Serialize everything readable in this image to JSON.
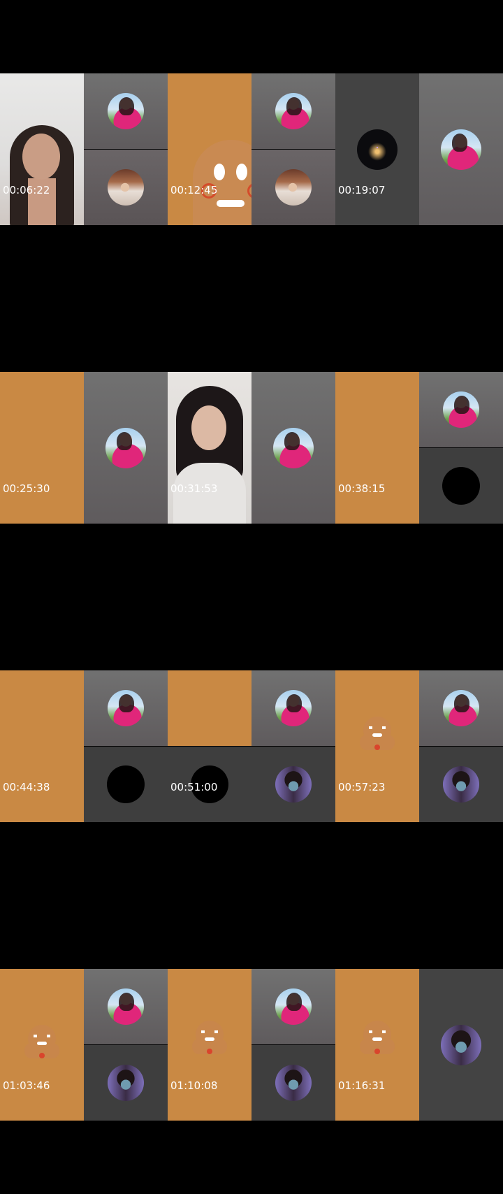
{
  "thumbnails": [
    {
      "timestamp": "00:06:22",
      "layout": "person-a | avatar-pink / avatar-man"
    },
    {
      "timestamp": "00:12:45",
      "layout": "gingerbread-large | avatar-pink / avatar-man"
    },
    {
      "timestamp": "00:19:07",
      "layout": "avatar-dark-logo | avatar-pink"
    },
    {
      "timestamp": "00:25:30",
      "layout": "orange | avatar-pink"
    },
    {
      "timestamp": "00:31:53",
      "layout": "person-b | avatar-pink"
    },
    {
      "timestamp": "00:38:15",
      "layout": "orange | avatar-pink / avatar-black"
    },
    {
      "timestamp": "00:44:38",
      "layout": "orange | avatar-pink / avatar-black"
    },
    {
      "timestamp": "00:51:00",
      "layout": "orange / avatar-black | avatar-pink / avatar-elephant"
    },
    {
      "timestamp": "00:57:23",
      "layout": "gingerbread-small | avatar-pink / avatar-elephant"
    },
    {
      "timestamp": "01:03:46",
      "layout": "gingerbread-small | avatar-pink / avatar-elephant"
    },
    {
      "timestamp": "01:10:08",
      "layout": "gingerbread-small | avatar-pink / avatar-elephant"
    },
    {
      "timestamp": "01:16:31",
      "layout": "gingerbread-small | avatar-elephant"
    }
  ],
  "colors": {
    "background": "#000000",
    "gingerbread_orange": "#c98944",
    "grey_panel": "#5f5b5d",
    "dark_panel": "#434343",
    "label_text": "#ffffff"
  },
  "icons": [
    "avatar-pink-icon",
    "avatar-man-icon",
    "avatar-dark-logo-icon",
    "avatar-black-icon",
    "avatar-elephant-icon",
    "gingerbread-icon"
  ]
}
